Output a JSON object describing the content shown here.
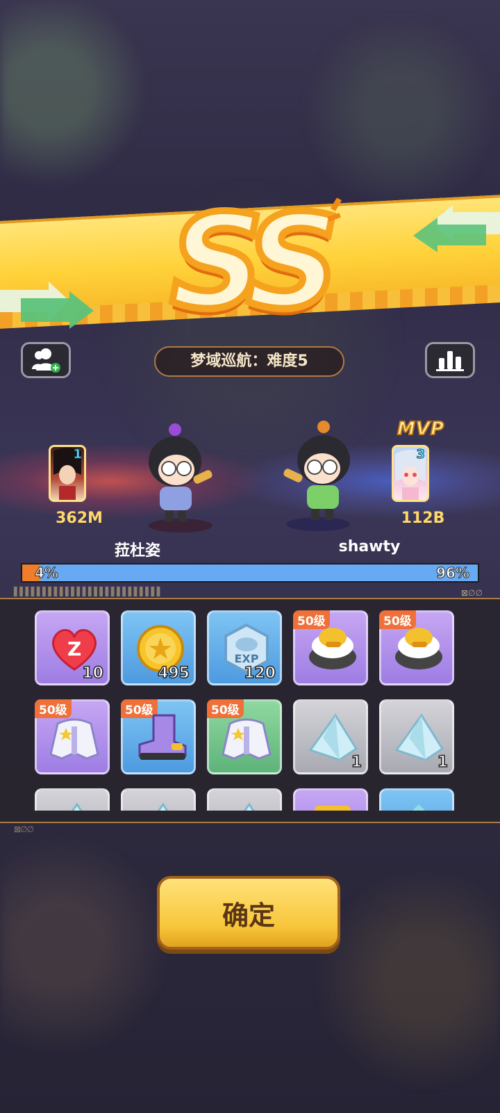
{
  "grade": "SS",
  "stage": "梦域巡航：难度5",
  "buttons": {
    "add_friend_icon": "add-friend-icon",
    "stats_icon": "bar-chart-icon",
    "confirm": "确定"
  },
  "players": [
    {
      "name": "菈杜姿",
      "power": "362M",
      "hero_level": "1",
      "share_percent": "4%",
      "share": 0.04,
      "mvp": false
    },
    {
      "name": "shawty",
      "power": "112B",
      "hero_level": "3",
      "share_percent": "96%",
      "share": 0.96,
      "mvp": true,
      "mvp_label": "MVP"
    }
  ],
  "rewards": [
    {
      "item": "heart",
      "qty": "10",
      "color": "purple"
    },
    {
      "item": "gold-coin",
      "qty": "495",
      "color": "blue"
    },
    {
      "item": "exp",
      "qty": "120",
      "color": "blue",
      "label": "EXP"
    },
    {
      "item": "duck-helmet",
      "level_tag": "50级",
      "color": "purple"
    },
    {
      "item": "duck-helmet",
      "level_tag": "50级",
      "color": "purple"
    },
    {
      "item": "white-jacket",
      "level_tag": "50级",
      "color": "purple"
    },
    {
      "item": "purple-boots",
      "level_tag": "50级",
      "color": "blue"
    },
    {
      "item": "white-jacket",
      "level_tag": "50级",
      "color": "green"
    },
    {
      "item": "crystal",
      "qty": "1",
      "color": "gray"
    },
    {
      "item": "crystal",
      "qty": "1",
      "color": "gray"
    },
    {
      "item": "crystal",
      "color": "gray"
    },
    {
      "item": "crystal",
      "color": "gray"
    },
    {
      "item": "crystal",
      "color": "gray"
    },
    {
      "item": "scroll",
      "color": "purple"
    },
    {
      "item": "gem",
      "color": "blue"
    }
  ]
}
